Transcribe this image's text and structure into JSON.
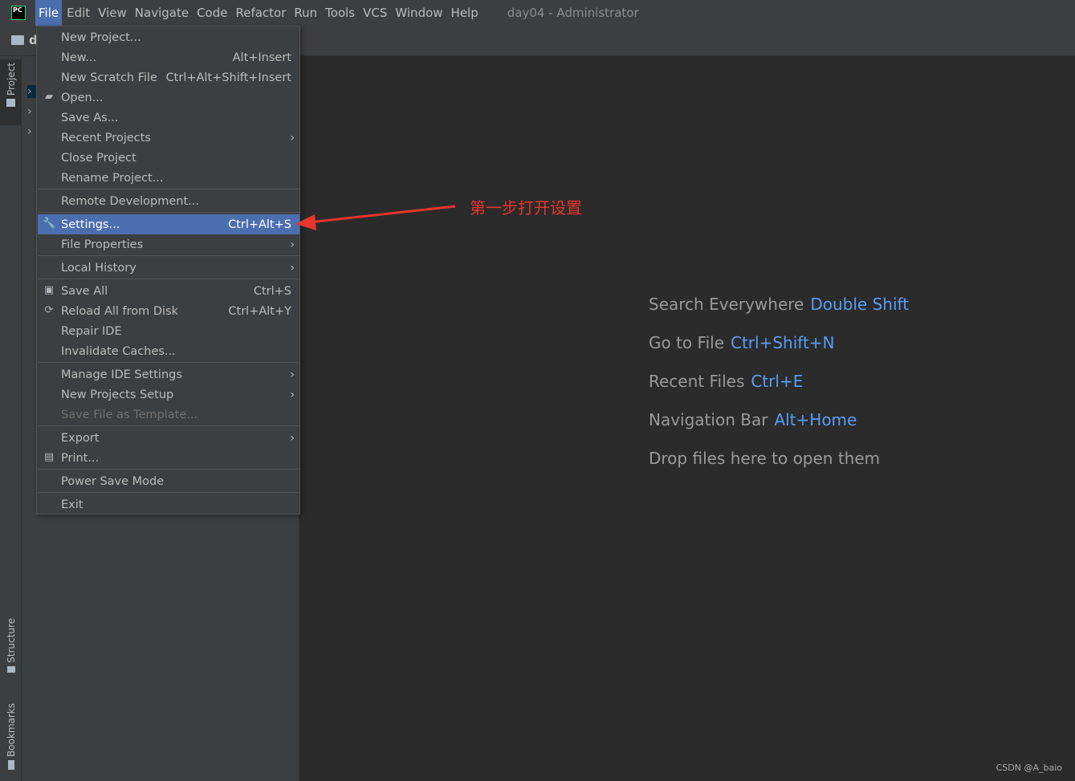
{
  "menubar": {
    "items": [
      "File",
      "Edit",
      "View",
      "Navigate",
      "Code",
      "Refactor",
      "Run",
      "Tools",
      "VCS",
      "Window",
      "Help"
    ],
    "window_title": "day04 - Administrator"
  },
  "toolbar": {
    "project_label": "d"
  },
  "left_strip": {
    "project": "Project",
    "structure": "Structure",
    "bookmarks": "Bookmarks"
  },
  "file_menu": {
    "new_project": "New Project...",
    "new": "New...",
    "new_sc": "Alt+Insert",
    "new_scratch": "New Scratch File",
    "new_scratch_sc": "Ctrl+Alt+Shift+Insert",
    "open": "Open...",
    "save_as": "Save As...",
    "recent_projects": "Recent Projects",
    "close_project": "Close Project",
    "rename_project": "Rename Project...",
    "remote_dev": "Remote Development...",
    "settings": "Settings...",
    "settings_sc": "Ctrl+Alt+S",
    "file_properties": "File Properties",
    "local_history": "Local History",
    "save_all": "Save All",
    "save_all_sc": "Ctrl+S",
    "reload": "Reload All from Disk",
    "reload_sc": "Ctrl+Alt+Y",
    "repair": "Repair IDE",
    "invalidate": "Invalidate Caches...",
    "manage_settings": "Manage IDE Settings",
    "new_projects_setup": "New Projects Setup",
    "save_template": "Save File as Template...",
    "export": "Export",
    "print": "Print...",
    "power_save": "Power Save Mode",
    "exit": "Exit"
  },
  "hints": [
    {
      "label": "Search Everywhere",
      "key": "Double Shift"
    },
    {
      "label": "Go to File",
      "key": "Ctrl+Shift+N"
    },
    {
      "label": "Recent Files",
      "key": "Ctrl+E"
    },
    {
      "label": "Navigation Bar",
      "key": "Alt+Home"
    },
    {
      "label": "Drop files here to open them",
      "key": ""
    }
  ],
  "annotation": {
    "text": "第一步打开设置",
    "color": "#e8352b"
  },
  "watermark": "CSDN @A_baio",
  "colors": {
    "accent": "#4b6eaf",
    "key": "#589df6",
    "bg": "#2b2b2b",
    "panel": "#3c3f41"
  }
}
